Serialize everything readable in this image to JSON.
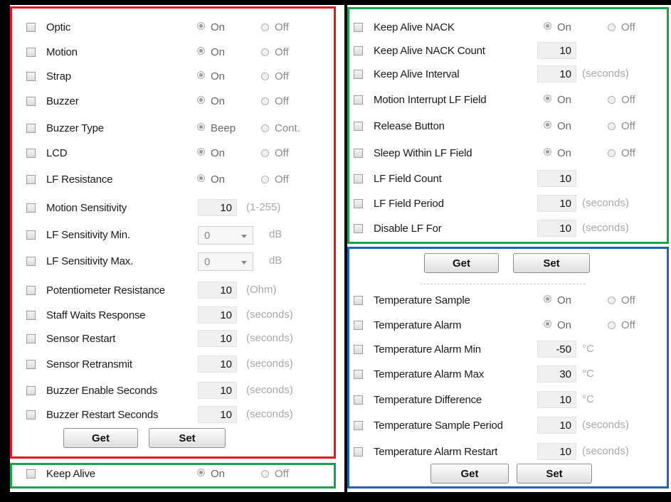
{
  "colors": {
    "red": "#e6141b",
    "green": "#1aa24a",
    "blue": "#1d63b8",
    "border": "#000000"
  },
  "left_panel": {
    "rows": [
      {
        "label": "Optic",
        "kind": "radio",
        "on": "On",
        "off": "Off"
      },
      {
        "label": "Motion",
        "kind": "radio",
        "on": "On",
        "off": "Off"
      },
      {
        "label": "Strap",
        "kind": "radio",
        "on": "On",
        "off": "Off"
      },
      {
        "label": "Buzzer",
        "kind": "radio",
        "on": "On",
        "off": "Off"
      },
      {
        "label": "Buzzer Type",
        "kind": "radio",
        "on": "Beep",
        "off": "Cont."
      },
      {
        "label": "LCD",
        "kind": "radio",
        "on": "On",
        "off": "Off"
      },
      {
        "label": "LF Resistance",
        "kind": "radio",
        "on": "On",
        "off": "Off"
      },
      {
        "label": "Motion Sensitivity",
        "kind": "num",
        "value": "10",
        "unit": "(1-255)"
      },
      {
        "label": "LF Sensitivity Min.",
        "kind": "select",
        "value": "0",
        "unit": "dB"
      },
      {
        "label": "LF Sensitivity Max.",
        "kind": "select",
        "value": "0",
        "unit": "dB"
      },
      {
        "label": "Potentiometer Resistance",
        "kind": "num",
        "value": "10",
        "unit": "(Ohm)"
      },
      {
        "label": "Staff Waits Response",
        "kind": "num",
        "value": "10",
        "unit": "(seconds)"
      },
      {
        "label": "Sensor Restart",
        "kind": "num",
        "value": "10",
        "unit": "(seconds)"
      },
      {
        "label": "Sensor Retransmit",
        "kind": "num",
        "value": "10",
        "unit": "(seconds)"
      },
      {
        "label": "Buzzer Enable Seconds",
        "kind": "num",
        "value": "10",
        "unit": "(seconds)"
      },
      {
        "label": "Buzzer Restart Seconds",
        "kind": "num",
        "value": "10",
        "unit": "(seconds)"
      }
    ],
    "get": "Get",
    "set": "Set"
  },
  "keep_alive": {
    "label": "Keep Alive",
    "on": "On",
    "off": "Off"
  },
  "top_right": {
    "rows": [
      {
        "label": "Keep Alive NACK",
        "kind": "radio",
        "on": "On",
        "off": "Off"
      },
      {
        "label": "Keep Alive NACK Count",
        "kind": "num",
        "value": "10",
        "unit": ""
      },
      {
        "label": "Keep Alive Interval",
        "kind": "num",
        "value": "10",
        "unit": "(seconds)"
      },
      {
        "label": "Motion Interrupt LF Field",
        "kind": "radio",
        "on": "On",
        "off": "Off"
      },
      {
        "label": "Release Button",
        "kind": "radio",
        "on": "On",
        "off": "Off"
      },
      {
        "label": "Sleep Within LF Field",
        "kind": "radio",
        "on": "On",
        "off": "Off"
      },
      {
        "label": "LF Field Count",
        "kind": "num",
        "value": "10",
        "unit": ""
      },
      {
        "label": "LF Field Period",
        "kind": "num",
        "value": "10",
        "unit": "(seconds)"
      },
      {
        "label": "Disable LF For",
        "kind": "num",
        "value": "10",
        "unit": "(seconds)"
      }
    ],
    "get": "Get",
    "set": "Set"
  },
  "bottom_right": {
    "rows": [
      {
        "label": "Temperature Sample",
        "kind": "radio",
        "on": "On",
        "off": "Off"
      },
      {
        "label": "Temperature Alarm",
        "kind": "radio",
        "on": "On",
        "off": "Off"
      },
      {
        "label": "Temperature Alarm Min",
        "kind": "num",
        "value": "-50",
        "unit": "°C"
      },
      {
        "label": "Temperature Alarm Max",
        "kind": "num",
        "value": "30",
        "unit": "°C"
      },
      {
        "label": "Temperature Difference",
        "kind": "num",
        "value": "10",
        "unit": "°C"
      },
      {
        "label": "Temperature Sample Period",
        "kind": "num",
        "value": "10",
        "unit": "(seconds)"
      },
      {
        "label": "Temperature Alarm Restart",
        "kind": "num",
        "value": "10",
        "unit": "(seconds)"
      }
    ],
    "get": "Get",
    "set": "Set"
  }
}
